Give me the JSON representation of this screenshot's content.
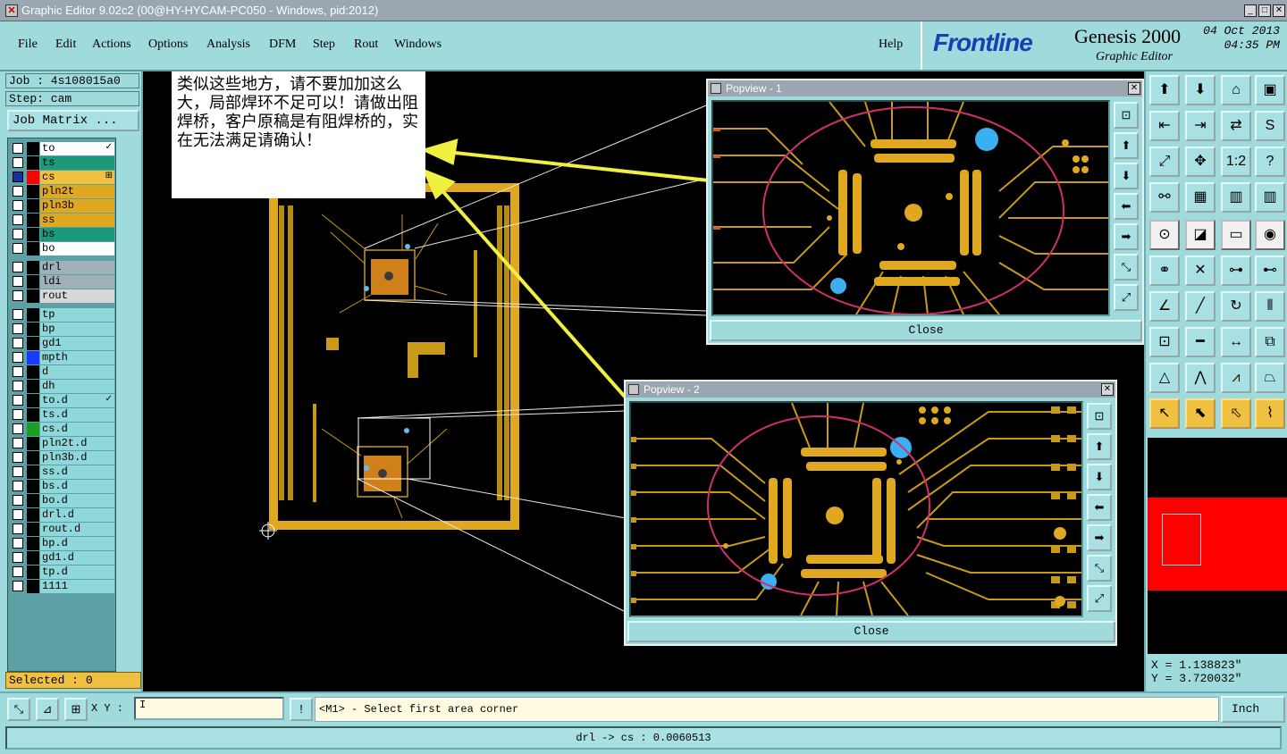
{
  "window": {
    "title": "Graphic Editor 9.02c2 (00@HY-HYCAM-PC050 - Windows, pid:2012)",
    "min": "_",
    "max": "□",
    "close": "✕"
  },
  "menu": {
    "items": [
      "File",
      "Edit",
      "Actions",
      "Options",
      "Analysis",
      "DFM",
      "Step",
      "Rout",
      "Windows"
    ],
    "help": "Help"
  },
  "brand": {
    "logo": "Frontline",
    "product": "Genesis 2000",
    "subtitle": "Graphic Editor",
    "date": "04 Oct 2013",
    "time": "04:35 PM"
  },
  "job": {
    "job_label": "Job : 4s108015a0",
    "step_label": "Step: cam",
    "matrix_button": "Job Matrix ..."
  },
  "layers": [
    {
      "name": "to",
      "color": "#ffffff",
      "swatch": "#000000",
      "checked": false,
      "tick": "✓"
    },
    {
      "name": "ts",
      "color": "#1a9a7a",
      "swatch": "#000000",
      "checked": false
    },
    {
      "name": "cs",
      "color": "#f0c040",
      "swatch": "#ff0000",
      "checked": true,
      "tick": "⊞"
    },
    {
      "name": "pln2t",
      "color": "#e0a820",
      "swatch": "#000000",
      "checked": false
    },
    {
      "name": "pln3b",
      "color": "#e0a820",
      "swatch": "#000000",
      "checked": false
    },
    {
      "name": "ss",
      "color": "#e0a820",
      "swatch": "#000000",
      "checked": false
    },
    {
      "name": "bs",
      "color": "#1a9a7a",
      "swatch": "#000000",
      "checked": false
    },
    {
      "name": "bo",
      "color": "#ffffff",
      "swatch": "#000000",
      "checked": false
    },
    {
      "name": "drl",
      "color": "#a0b0b8",
      "swatch": "#000000",
      "checked": false
    },
    {
      "name": "ldi",
      "color": "#a0b0b8",
      "swatch": "#000000",
      "checked": false
    },
    {
      "name": "rout",
      "color": "#d8d8d8",
      "swatch": "#000000",
      "checked": false
    },
    {
      "name": "tp",
      "color": "#8ed8dc",
      "swatch": "#000000",
      "checked": false
    },
    {
      "name": "bp",
      "color": "#8ed8dc",
      "swatch": "#000000",
      "checked": false
    },
    {
      "name": "gd1",
      "color": "#8ed8dc",
      "swatch": "#000000",
      "checked": false
    },
    {
      "name": "mpth",
      "color": "#8ed8dc",
      "swatch": "#1a3aff",
      "checked": false
    },
    {
      "name": "d",
      "color": "#8ed8dc",
      "swatch": "#000000",
      "checked": false
    },
    {
      "name": "dh",
      "color": "#8ed8dc",
      "swatch": "#000000",
      "checked": false
    },
    {
      "name": "to.d",
      "color": "#8ed8dc",
      "swatch": "#000000",
      "checked": false,
      "tick": "✓"
    },
    {
      "name": "ts.d",
      "color": "#8ed8dc",
      "swatch": "#000000",
      "checked": false
    },
    {
      "name": "cs.d",
      "color": "#8ed8dc",
      "swatch": "#1aa020",
      "checked": false
    },
    {
      "name": "pln2t.d",
      "color": "#8ed8dc",
      "swatch": "#000000",
      "checked": false
    },
    {
      "name": "pln3b.d",
      "color": "#8ed8dc",
      "swatch": "#000000",
      "checked": false
    },
    {
      "name": "ss.d",
      "color": "#8ed8dc",
      "swatch": "#000000",
      "checked": false
    },
    {
      "name": "bs.d",
      "color": "#8ed8dc",
      "swatch": "#000000",
      "checked": false
    },
    {
      "name": "bo.d",
      "color": "#8ed8dc",
      "swatch": "#000000",
      "checked": false
    },
    {
      "name": "drl.d",
      "color": "#8ed8dc",
      "swatch": "#000000",
      "checked": false
    },
    {
      "name": "rout.d",
      "color": "#8ed8dc",
      "swatch": "#000000",
      "checked": false
    },
    {
      "name": "bp.d",
      "color": "#8ed8dc",
      "swatch": "#000000",
      "checked": false
    },
    {
      "name": "gd1.d",
      "color": "#8ed8dc",
      "swatch": "#000000",
      "checked": false
    },
    {
      "name": "tp.d",
      "color": "#8ed8dc",
      "swatch": "#000000",
      "checked": false
    },
    {
      "name": "1111",
      "color": "#8ed8dc",
      "swatch": "#000000",
      "checked": false
    }
  ],
  "selected_label": "Selected : 0",
  "note": {
    "text": "类似这些地方，请不要加加这么大，局部焊环不足可以！请做出阻焊桥，客户原稿是有阻焊桥的，实在无法满足请确认！"
  },
  "popview1": {
    "title": "Popview - 1",
    "close_label": "Close"
  },
  "popview2": {
    "title": "Popview - 2",
    "close_label": "Close"
  },
  "coords": {
    "x": "X = 1.138823\"",
    "y": "Y = 3.720032\""
  },
  "command": {
    "xy_label": "X Y :",
    "xy_value": "I",
    "bang": "!",
    "message": "<M1> - Select first area corner",
    "unit": "Inch"
  },
  "status": "drl -> cs : 0.0060513"
}
